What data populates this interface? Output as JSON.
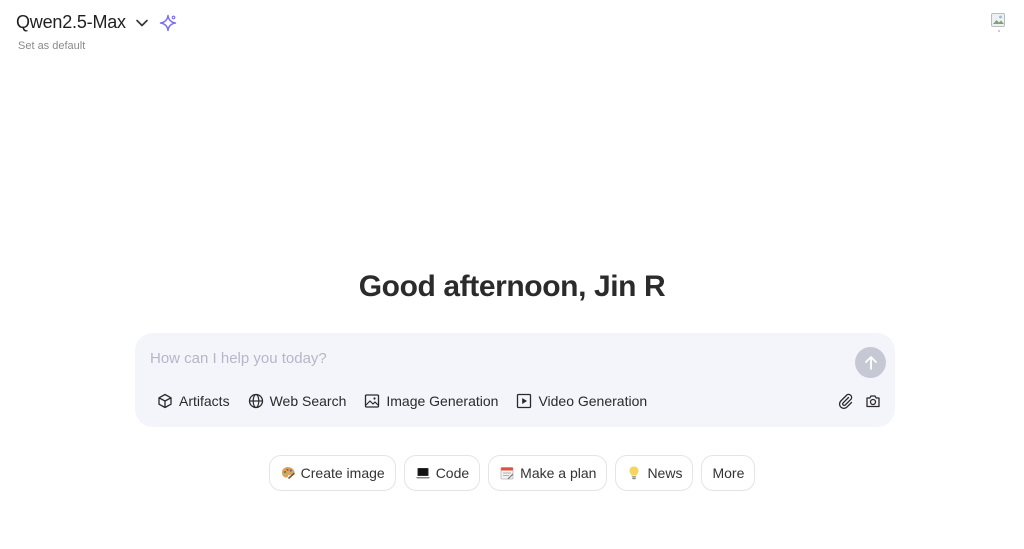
{
  "header": {
    "model_name": "Qwen2.5-Max",
    "set_default": "Set as default",
    "chevron_icon": "chevron-down-icon",
    "spark_icon": "sparkle-icon"
  },
  "greeting": "Good afternoon, Jin R",
  "composer": {
    "placeholder": "How can I help you today?",
    "send_icon": "arrow-up-icon",
    "tools": [
      {
        "label": "Artifacts",
        "icon": "cube-icon"
      },
      {
        "label": "Web Search",
        "icon": "globe-icon"
      },
      {
        "label": "Image Generation",
        "icon": "image-icon"
      },
      {
        "label": "Video Generation",
        "icon": "play-square-icon"
      }
    ],
    "right_tools": [
      {
        "icon": "paperclip-icon"
      },
      {
        "icon": "camera-icon"
      }
    ]
  },
  "chips": [
    {
      "label": "Create image",
      "icon": "palette-icon"
    },
    {
      "label": "Code",
      "icon": "laptop-icon"
    },
    {
      "label": "Make a plan",
      "icon": "calendar-icon"
    },
    {
      "label": "News",
      "icon": "lightbulb-icon"
    },
    {
      "label": "More",
      "icon": ""
    }
  ],
  "colors": {
    "composer_bg": "#f4f5fb",
    "send_button": "#c6c8d4",
    "accent": "#7b6cf6"
  }
}
